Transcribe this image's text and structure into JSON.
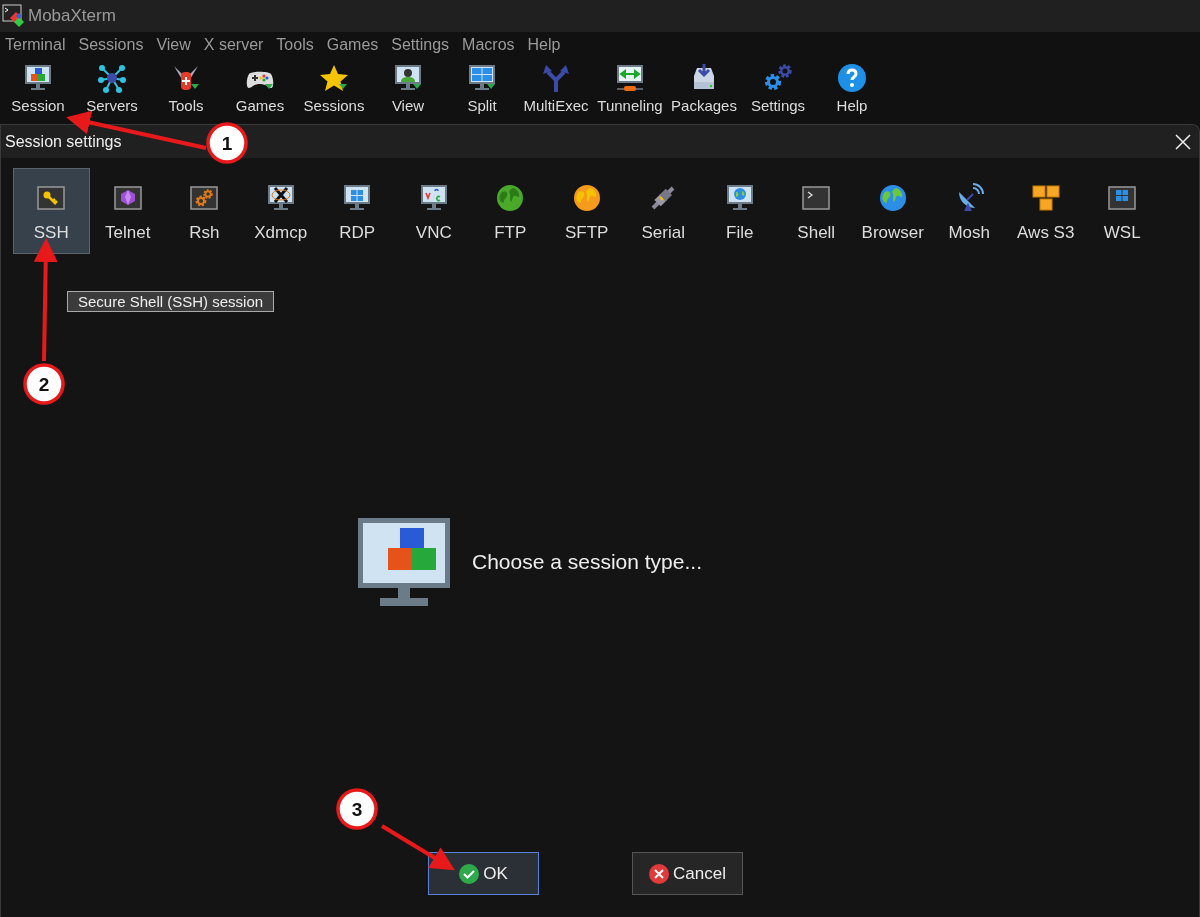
{
  "window": {
    "title": "MobaXterm"
  },
  "menu": [
    "Terminal",
    "Sessions",
    "View",
    "X server",
    "Tools",
    "Games",
    "Settings",
    "Macros",
    "Help"
  ],
  "toolbar": [
    "Session",
    "Servers",
    "Tools",
    "Games",
    "Sessions",
    "View",
    "Split",
    "MultiExec",
    "Tunneling",
    "Packages",
    "Settings",
    "Help"
  ],
  "dialog": {
    "title": "Session settings",
    "session_types": [
      {
        "label": "SSH",
        "selected": true
      },
      {
        "label": "Telnet",
        "selected": false
      },
      {
        "label": "Rsh",
        "selected": false
      },
      {
        "label": "Xdmcp",
        "selected": false
      },
      {
        "label": "RDP",
        "selected": false
      },
      {
        "label": "VNC",
        "selected": false
      },
      {
        "label": "FTP",
        "selected": false
      },
      {
        "label": "SFTP",
        "selected": false
      },
      {
        "label": "Serial",
        "selected": false
      },
      {
        "label": "File",
        "selected": false
      },
      {
        "label": "Shell",
        "selected": false
      },
      {
        "label": "Browser",
        "selected": false
      },
      {
        "label": "Mosh",
        "selected": false
      },
      {
        "label": "Aws S3",
        "selected": false
      },
      {
        "label": "WSL",
        "selected": false
      }
    ],
    "tooltip": "Secure Shell (SSH) session",
    "prompt": "Choose a session type...",
    "buttons": [
      {
        "label": "OK",
        "kind": "ok",
        "focused": true
      },
      {
        "label": "Cancel",
        "kind": "cancel",
        "focused": false
      }
    ]
  },
  "annotations": [
    "1",
    "2",
    "3"
  ]
}
